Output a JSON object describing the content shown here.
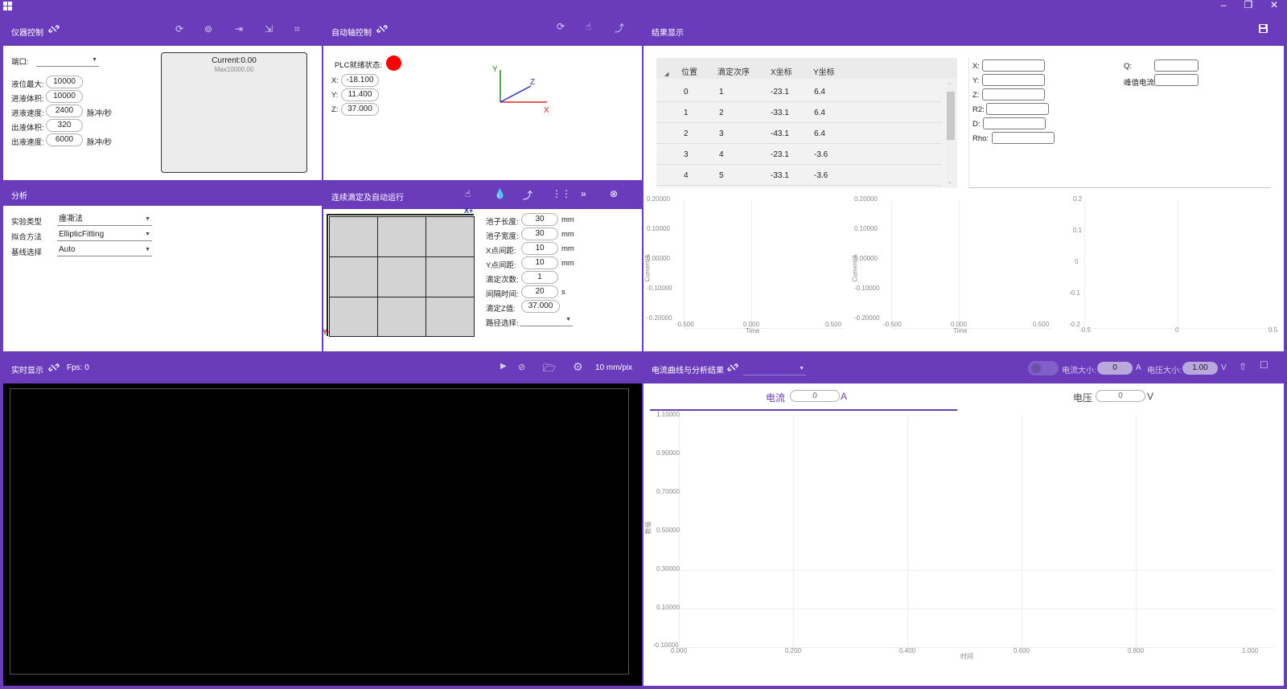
{
  "window": {
    "minimize": "–",
    "restore": "❐",
    "close": "✕"
  },
  "instrument": {
    "title": "仪器控制",
    "port_label": "端口:",
    "rows": [
      {
        "label": "液位最大:",
        "value": "10000",
        "unit": ""
      },
      {
        "label": "进液体积:",
        "value": "10000",
        "unit": ""
      },
      {
        "label": "进液速度:",
        "value": "2400",
        "unit": "脉冲/秒"
      },
      {
        "label": "出液体积:",
        "value": "320",
        "unit": ""
      },
      {
        "label": "出液速度:",
        "value": "6000",
        "unit": "脉冲/秒"
      }
    ],
    "current": "Current:0.00",
    "max": "Max10000.00"
  },
  "axis": {
    "title": "自动轴控制",
    "plc_label": "PLC就绪状态:",
    "status_color": "#ff0000",
    "x_label": "X:",
    "x": "-18.100",
    "y_label": "Y:",
    "y": "11.400",
    "z_label": "Z:",
    "z": "37.000",
    "ax_x": "X",
    "ax_y": "Y",
    "ax_z": "Z"
  },
  "results": {
    "title": "结果显示",
    "columns": [
      "位置",
      "滴定次序",
      "X坐标",
      "Y坐标"
    ],
    "rows": [
      [
        "0",
        "1",
        "-23.1",
        "6.4"
      ],
      [
        "1",
        "2",
        "-33.1",
        "6.4"
      ],
      [
        "2",
        "3",
        "-43.1",
        "6.4"
      ],
      [
        "3",
        "4",
        "-23.1",
        "-3.6"
      ],
      [
        "4",
        "5",
        "-33.1",
        "-3.6"
      ]
    ],
    "fields_left": [
      "X:",
      "Y:",
      "Z:",
      "R2:",
      "D:",
      "Rho:"
    ],
    "q_label": "Q:",
    "peak_label": "峰值电流:"
  },
  "mini_charts": {
    "ylabel": "Current/A",
    "xlabel": "Time",
    "chart1_y": [
      "0.20000",
      "0.10000",
      "0.00000",
      "-0.10000",
      "-0.20000"
    ],
    "chart1_x": [
      "-0.500",
      "0.000",
      "0.500"
    ],
    "chart3_y": [
      "0.2",
      "0.1",
      "0",
      "-0.1",
      "-0.2"
    ],
    "chart3_x": [
      "-0.5",
      "0",
      "0.5"
    ]
  },
  "analysis": {
    "title": "分析",
    "rows": [
      {
        "label": "实验类型",
        "value": "瘗凘法"
      },
      {
        "label": "拟合方法",
        "value": "EllipticFitting"
      },
      {
        "label": "基线选择",
        "value": "Auto"
      }
    ]
  },
  "titration": {
    "title": "连续滴定及自动运行",
    "x_marker": "X+",
    "y_marker": "Y+",
    "rows": [
      {
        "label": "池子长度:",
        "value": "30",
        "unit": "mm"
      },
      {
        "label": "池子宽度:",
        "value": "30",
        "unit": "mm"
      },
      {
        "label": "X点间距:",
        "value": "10",
        "unit": "mm"
      },
      {
        "label": "Y点间距:",
        "value": "10",
        "unit": "mm"
      },
      {
        "label": "滴定次数:",
        "value": "1",
        "unit": ""
      },
      {
        "label": "间隔时间:",
        "value": "20",
        "unit": "s"
      },
      {
        "label": "滴定Z值:",
        "value": "37.000",
        "unit": ""
      }
    ],
    "path_label": "路径选择:"
  },
  "realtime": {
    "title": "实时显示",
    "fps": "Fps:  0",
    "scale": "10 mm/pix"
  },
  "curve": {
    "title": "电流曲线与分析结果",
    "current_size_label": "电流大小:",
    "current_size": "0",
    "current_unit": "A",
    "voltage_size_label": "电压大小:",
    "voltage_size": "1.00",
    "voltage_unit": "V",
    "tab_current": "电流",
    "tab_current_value": "0",
    "tab_current_unit": "A",
    "tab_voltage": "电压",
    "tab_voltage_value": "0",
    "tab_voltage_unit": "V",
    "ylabel": "数值",
    "xlabel": "时间",
    "y_ticks": [
      "1.10000",
      "0.90000",
      "0.70000",
      "0.50000",
      "0.30000",
      "0.10000",
      "-0.10000"
    ],
    "x_ticks": [
      "0.000",
      "0.200",
      "0.400",
      "0.600",
      "0.800",
      "1.000"
    ]
  },
  "colors": {
    "accent": "#6a3cbc",
    "plc_status": "#ff0000",
    "canvas": "#000000"
  }
}
